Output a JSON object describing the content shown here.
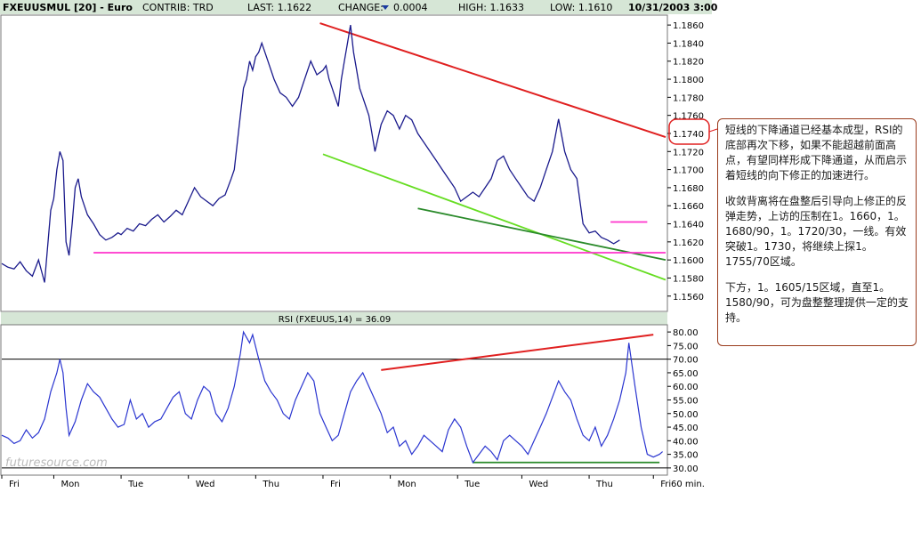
{
  "header": {
    "symbol": "FXEUUSMUL [20] - Euro",
    "contrib": "CONTRIB: TRD",
    "last": "LAST: 1.1622",
    "change_label": "CHANGE:",
    "change_value": "0.0004",
    "high": "HIGH: 1.1633",
    "low": "LOW: 1.1610",
    "datetime": "10/31/2003 3:00"
  },
  "rsi_title": "RSI (FXEUUS,14) = 36.09",
  "watermark": "futuresource.com",
  "interval": "60 min.",
  "annotation": [
    "短线的下降通道已经基本成型，RSI的底部再次下移，如果不能超越前面高点，有望同样形成下降通道，从而启示着短线的向下修正的加速进行。",
    "收敛背离将在盘整后引导向上修正的反弹走势，上访的压制在1。1660，1。1680/90，1。1720/30，一线。有效突破1。1730，将继续上探1。1755/70区域。",
    "下方，1。1605/15区域，直至1。1580/90，可为盘整整理提供一定的支持。"
  ],
  "colors": {
    "price_line": "#1a1a8c",
    "rsi_line": "#2a35d0",
    "resistance": "#e02020",
    "support_upper": "#66dd22",
    "support_lower": "#2a8a2a",
    "horizontal": "#ff33cc",
    "header_bg": "#d6e6d6"
  },
  "chart_data": [
    {
      "type": "line",
      "title": "FXEUUSMUL [20] - Euro",
      "ylim": [
        1.1545,
        1.1868
      ],
      "y_ticks": [
        "1.1860",
        "1.1840",
        "1.1820",
        "1.1800",
        "1.1780",
        "1.1760",
        "1.1740",
        "1.1720",
        "1.1700",
        "1.1680",
        "1.1660",
        "1.1640",
        "1.1620",
        "1.1600",
        "1.1580",
        "1.1560"
      ],
      "x_ticks": [
        "Fri",
        "Mon",
        "Tue",
        "Wed",
        "Thu",
        "Fri",
        "Mon",
        "Tue",
        "Wed",
        "Thu",
        "Fri"
      ],
      "x_tick_positions": [
        0,
        17,
        39,
        61,
        83,
        105,
        127,
        149,
        170,
        192,
        213
      ],
      "x_range": [
        0,
        217
      ],
      "series": [
        {
          "values": [
            1.1596,
            1.1592,
            1.159,
            1.1598,
            1.1588,
            1.1582,
            1.16,
            1.1575,
            1.1655,
            1.1668,
            1.17,
            1.172,
            1.171,
            1.162,
            1.1605,
            1.164,
            1.168,
            1.169,
            1.167,
            1.166,
            1.165,
            1.164,
            1.1628,
            1.1622,
            1.1625,
            1.163,
            1.1628,
            1.1635,
            1.1632,
            1.164,
            1.1638,
            1.1645,
            1.165,
            1.1642,
            1.1648,
            1.1655,
            1.165,
            1.1665,
            1.168,
            1.167,
            1.1665,
            1.166,
            1.1668,
            1.1672,
            1.169,
            1.17,
            1.173,
            1.176,
            1.179,
            1.18,
            1.182,
            1.181,
            1.1825,
            1.183,
            1.184,
            1.182,
            1.18,
            1.1785,
            1.178,
            1.177,
            1.178,
            1.18,
            1.182,
            1.1805,
            1.181,
            1.1815,
            1.18,
            1.179,
            1.178,
            1.177,
            1.18,
            1.182,
            1.184,
            1.186,
            1.183,
            1.181,
            1.179,
            1.178,
            1.177,
            1.176,
            1.174,
            1.172,
            1.175,
            1.1765,
            1.176,
            1.1745,
            1.176,
            1.1755,
            1.174,
            1.173,
            1.172,
            1.171,
            1.17,
            1.169,
            1.168,
            1.1665,
            1.167,
            1.1675,
            1.167,
            1.168,
            1.169,
            1.171,
            1.1715,
            1.17,
            1.169,
            1.168,
            1.167,
            1.1665,
            1.168,
            1.17,
            1.172,
            1.1756,
            1.172,
            1.17,
            1.169,
            1.164,
            1.163,
            1.1632,
            1.1625,
            1.1622,
            1.1618,
            1.1622
          ],
          "index_positions": [
            0,
            2,
            4,
            6,
            8,
            10,
            12,
            14,
            16,
            17,
            18,
            19,
            20,
            21,
            22,
            23,
            24,
            25,
            26,
            27,
            28,
            30,
            32,
            34,
            36,
            38,
            39,
            41,
            43,
            45,
            47,
            49,
            51,
            53,
            55,
            57,
            59,
            61,
            63,
            65,
            67,
            69,
            71,
            73,
            75,
            76,
            77,
            78,
            79,
            80,
            81,
            82,
            83,
            84,
            85,
            87,
            89,
            91,
            93,
            95,
            97,
            99,
            101,
            103,
            105,
            106,
            107,
            108,
            109,
            110,
            111,
            112,
            113,
            114,
            115,
            116,
            117,
            118,
            119,
            120,
            121,
            122,
            124,
            126,
            128,
            130,
            132,
            134,
            136,
            138,
            140,
            142,
            144,
            146,
            148,
            150,
            152,
            154,
            156,
            158,
            160,
            162,
            164,
            166,
            168,
            170,
            172,
            174,
            176,
            178,
            180,
            182,
            184,
            186,
            188,
            190,
            192,
            194,
            196,
            198,
            200,
            202,
            204,
            206,
            208,
            210,
            212,
            214
          ]
        }
      ],
      "overlays": [
        {
          "kind": "resistance",
          "from": [
            104,
            1.1862
          ],
          "to": [
            217,
            1.1736
          ]
        },
        {
          "kind": "support_upper",
          "from": [
            105,
            1.1717
          ],
          "to": [
            217,
            1.1578
          ]
        },
        {
          "kind": "support_lower",
          "from": [
            136,
            1.1657
          ],
          "to": [
            217,
            1.16
          ]
        },
        {
          "kind": "horizontal",
          "from": [
            30,
            1.1608
          ],
          "to": [
            217,
            1.1608
          ]
        },
        {
          "kind": "horizontal_short",
          "from": [
            199,
            1.1642
          ],
          "to": [
            211,
            1.1642
          ]
        }
      ]
    },
    {
      "type": "line",
      "title": "RSI (FXEUUS,14) = 36.09",
      "ylim": [
        28,
        82
      ],
      "y_ticks": [
        "80.00",
        "75.00",
        "70.00",
        "65.00",
        "60.00",
        "55.00",
        "50.00",
        "45.00",
        "40.00",
        "35.00",
        "30.00"
      ],
      "reference_lines": [
        70,
        30
      ],
      "x_range": [
        0,
        217
      ],
      "series": [
        {
          "values": [
            42,
            41,
            39,
            40,
            44,
            41,
            43,
            48,
            58,
            65,
            70,
            65,
            52,
            42,
            47,
            55,
            61,
            58,
            56,
            52,
            48,
            45,
            46,
            55,
            48,
            50,
            45,
            47,
            48,
            52,
            56,
            58,
            50,
            48,
            55,
            60,
            58,
            50,
            47,
            52,
            60,
            72,
            80,
            78,
            76,
            79,
            70,
            62,
            58,
            55,
            50,
            48,
            55,
            60,
            65,
            62,
            50,
            45,
            40,
            42,
            50,
            58,
            62,
            65,
            60,
            55,
            50,
            43,
            45,
            38,
            40,
            35,
            38,
            42,
            40,
            38,
            36,
            44,
            48,
            45,
            38,
            32,
            35,
            38,
            36,
            33,
            40,
            42,
            40,
            38,
            35,
            40,
            45,
            50,
            56,
            62,
            58,
            55,
            48,
            42,
            40,
            45,
            38,
            42,
            48,
            55,
            65,
            76,
            60,
            45,
            35,
            34,
            35,
            36
          ],
          "index_positions": [
            0,
            2,
            4,
            6,
            8,
            10,
            12,
            14,
            16,
            18,
            19,
            20,
            21,
            22,
            24,
            26,
            28,
            30,
            32,
            34,
            36,
            38,
            40,
            42,
            44,
            46,
            48,
            50,
            52,
            54,
            56,
            58,
            60,
            62,
            64,
            66,
            68,
            70,
            72,
            74,
            76,
            78,
            79,
            80,
            81,
            82,
            84,
            86,
            88,
            90,
            92,
            94,
            96,
            98,
            100,
            102,
            104,
            106,
            108,
            110,
            112,
            114,
            116,
            118,
            120,
            122,
            124,
            126,
            128,
            130,
            132,
            134,
            136,
            138,
            140,
            142,
            144,
            146,
            148,
            150,
            152,
            154,
            156,
            158,
            160,
            162,
            164,
            166,
            168,
            170,
            172,
            174,
            176,
            178,
            180,
            182,
            184,
            186,
            188,
            190,
            192,
            194,
            196,
            198,
            200,
            202,
            204,
            205,
            207,
            209,
            211,
            213,
            215,
            216
          ]
        }
      ],
      "overlays": [
        {
          "kind": "resistance",
          "from": [
            124,
            66
          ],
          "to": [
            213,
            79
          ]
        },
        {
          "kind": "support_lower",
          "from": [
            154,
            32
          ],
          "to": [
            215,
            32
          ]
        }
      ]
    }
  ]
}
